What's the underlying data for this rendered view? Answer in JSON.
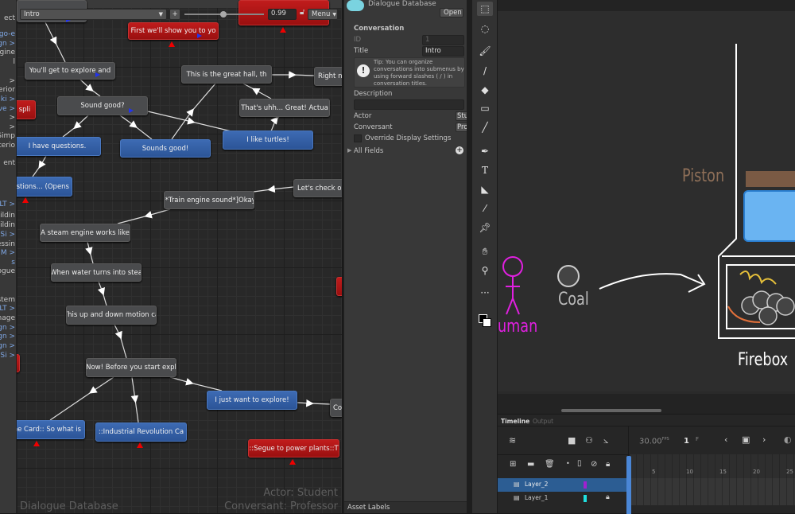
{
  "sidebar": {
    "items": [
      {
        "label": "ect",
        "blue": false
      },
      {
        "label": "ogo-e",
        "blue": true
      },
      {
        "label": "gn >",
        "blue": true
      },
      {
        "label": "gine",
        "blue": false
      },
      {
        "label": "l",
        "blue": false
      },
      {
        "label": ">",
        "blue": false
      },
      {
        "label": "terior",
        "blue": false
      },
      {
        "label": "ki >",
        "blue": true
      },
      {
        "label": "ve >",
        "blue": true
      },
      {
        "label": ">",
        "blue": false
      },
      {
        "label": ">",
        "blue": false
      },
      {
        "label": "Simp",
        "blue": false
      },
      {
        "label": "terio",
        "blue": false
      },
      {
        "label": "ent",
        "blue": false
      },
      {
        "label": "LT >",
        "blue": true
      },
      {
        "label": "uildin",
        "blue": false
      },
      {
        "label": "uildin",
        "blue": false
      },
      {
        "label": "Si >",
        "blue": true
      },
      {
        "label": "essin",
        "blue": false
      },
      {
        "label": "M >",
        "blue": true
      },
      {
        "label": "s",
        "blue": true
      },
      {
        "label": "ogue",
        "blue": false
      },
      {
        "label": "stem",
        "blue": false
      },
      {
        "label": "LT >",
        "blue": true
      },
      {
        "label": "nage",
        "blue": false
      },
      {
        "label": "gn >",
        "blue": true
      },
      {
        "label": "gn >",
        "blue": true
      },
      {
        "label": "gn >",
        "blue": true
      },
      {
        "label": "Si >",
        "blue": true
      }
    ]
  },
  "toolbar": {
    "conversation": "Intro",
    "add": "+",
    "zoom": "0.99",
    "menu": "Menu"
  },
  "nodes": {
    "first_show": "First we'll show you to yo",
    "explore": "You'll get to explore and",
    "great_hall": "This is the great hall, th",
    "right_now": "Right ne",
    "spli": "spli",
    "sound_good": "Sound good?",
    "thats_uhh": "That's uhh... Great! Actua",
    "questions": "I have questions.",
    "sounds_good": "Sounds good!",
    "turtles": "I like turtles!",
    "questions_opens": "stions... (Opens",
    "check_out": "Let's check ou",
    "train": "[*Train engine sound*]Okay",
    "steam_engine": "A steam engine works like",
    "water": "When water turns into stea",
    "up_down": "This up and down motion ca",
    "now_before": "Now! Before you start expl",
    "just_explore": "I just want to explore!",
    "co": "Co",
    "card": "he Card:: So what is",
    "industrial": "::Industrial Revolution Ca",
    "segue": "::Segue to power plants::T"
  },
  "graph_footer": {
    "title": "Dialogue Database",
    "actor": "Actor: Student",
    "conversant": "Conversant: Professor"
  },
  "inspector": {
    "header": "Dialogue Database",
    "open": "Open",
    "section": "Conversation",
    "id_label": "ID",
    "id_value": "1",
    "title_label": "Title",
    "title_value": "Intro",
    "tip": "Tip: You can organize conversations into submenus by using forward slashes ( / ) in conversation titles.",
    "description_label": "Description",
    "description_value": "",
    "actor_label": "Actor",
    "actor_value": "Stu",
    "conversant_label": "Conversant",
    "conversant_value": "Pro",
    "override": "Override Display Settings",
    "override_checked": false,
    "all_fields": "All Fields",
    "asset_labels": "Asset Labels"
  },
  "stage": {
    "labels": {
      "piston": "Piston",
      "coal": "Coal",
      "human": "uman",
      "firebox": "Firebox"
    }
  },
  "timeline": {
    "tabs": [
      "Timeline",
      "Output"
    ],
    "fps": "30.00",
    "fps_unit": "FPS",
    "frame": "1",
    "frame_unit": "F",
    "ruler": [
      "5",
      "10",
      "15",
      "20",
      "25"
    ],
    "layers": [
      {
        "name": "Layer_2",
        "color": "#a020d0",
        "selected": true,
        "locked": false
      },
      {
        "name": "Layer_1",
        "color": "#20e0e0",
        "selected": false,
        "locked": true
      }
    ]
  },
  "colors": {
    "blue_node": "#2f5a9e",
    "red_node": "#b01616",
    "gray_node": "#4a4b4d",
    "selection": "#2c5d93"
  }
}
